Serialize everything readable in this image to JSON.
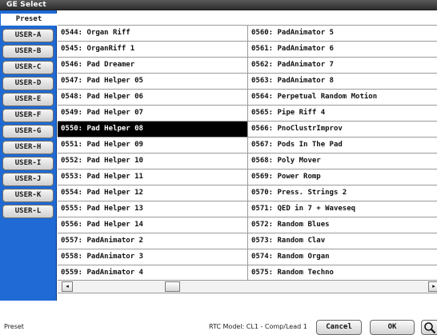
{
  "window": {
    "title": "GE Select"
  },
  "tabs": [
    {
      "label": "Preset",
      "active": true
    },
    {
      "label": "USER-A"
    },
    {
      "label": "USER-B"
    },
    {
      "label": "USER-C"
    },
    {
      "label": "USER-D"
    },
    {
      "label": "USER-E"
    },
    {
      "label": "USER-F"
    },
    {
      "label": "USER-G"
    },
    {
      "label": "USER-H"
    },
    {
      "label": "USER-I"
    },
    {
      "label": "USER-J"
    },
    {
      "label": "USER-K"
    },
    {
      "label": "USER-L"
    }
  ],
  "grid": {
    "selected": "0550: Pad Helper 08",
    "rows": [
      [
        "0544: Organ Riff",
        "0560: PadAnimator 5"
      ],
      [
        "0545: OrganRiff 1",
        "0561: PadAnimator 6"
      ],
      [
        "0546: Pad Dreamer",
        "0562: PadAnimator 7"
      ],
      [
        "0547: Pad Helper 05",
        "0563: PadAnimator 8"
      ],
      [
        "0548: Pad Helper 06",
        "0564: Perpetual Random Motion"
      ],
      [
        "0549: Pad Helper 07",
        "0565: Pipe Riff 4"
      ],
      [
        "0550: Pad Helper 08",
        "0566: PnoClustrImprov"
      ],
      [
        "0551: Pad Helper 09",
        "0567: Pods In The Pad"
      ],
      [
        "0552: Pad Helper 10",
        "0568: Poly Mover"
      ],
      [
        "0553: Pad Helper 11",
        "0569: Power Romp"
      ],
      [
        "0554: Pad Helper 12",
        "0570: Press. Strings 2"
      ],
      [
        "0555: Pad Helper 13",
        "0571: QED in 7 + Waveseq"
      ],
      [
        "0556: Pad Helper 14",
        "0572: Random Blues"
      ],
      [
        "0557: PadAnimator 2",
        "0573: Random Clav"
      ],
      [
        "0558: PadAnimator 3",
        "0574: Random Organ"
      ],
      [
        "0559: PadAnimator 4",
        "0575: Random Techno"
      ]
    ]
  },
  "scrollbar": {
    "left_arrow": "◂",
    "right_arrow": "▸"
  },
  "footer": {
    "category": "Preset",
    "rtc_label": "RTC Model:",
    "rtc_value": "CL1 - Comp/Lead 1",
    "cancel_label": "Cancel",
    "ok_label": "OK"
  },
  "colors": {
    "sidebar": "#1f6ad4",
    "selected_bg": "#000000",
    "titlebar": "#3a3a3a"
  }
}
